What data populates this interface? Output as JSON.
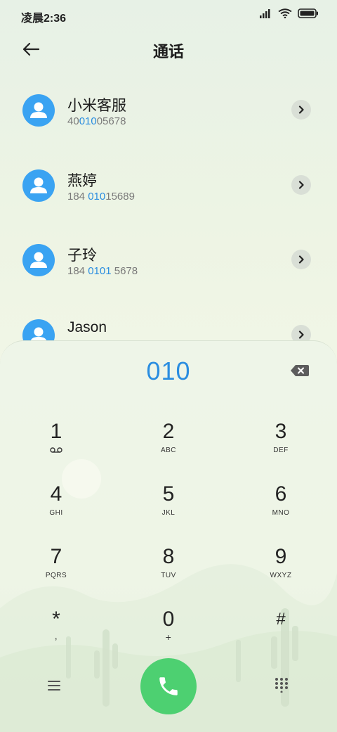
{
  "status_bar": {
    "time": "凌晨2:36"
  },
  "header": {
    "title": "通话"
  },
  "contacts": [
    {
      "name": "小米客服",
      "number_pre": "40",
      "number_hl": "010",
      "number_post": "05678"
    },
    {
      "name": "燕婷",
      "number_pre": "184 ",
      "number_hl": "010",
      "number_post": "15689"
    },
    {
      "name": "子玲",
      "number_pre": "184 ",
      "number_hl": "0101",
      "number_post": " 5678"
    },
    {
      "name": "Jason",
      "number_pre": "",
      "number_hl": "",
      "number_post": ""
    }
  ],
  "dialpad": {
    "input": "010",
    "keys": [
      {
        "digit": "1",
        "letters": ""
      },
      {
        "digit": "2",
        "letters": "ABC"
      },
      {
        "digit": "3",
        "letters": "DEF"
      },
      {
        "digit": "4",
        "letters": "GHI"
      },
      {
        "digit": "5",
        "letters": "JKL"
      },
      {
        "digit": "6",
        "letters": "MNO"
      },
      {
        "digit": "7",
        "letters": "PQRS"
      },
      {
        "digit": "8",
        "letters": "TUV"
      },
      {
        "digit": "9",
        "letters": "WXYZ"
      },
      {
        "digit": "*",
        "letters": ","
      },
      {
        "digit": "0",
        "letters": "+"
      },
      {
        "digit": "#",
        "letters": ""
      }
    ]
  },
  "icons": {
    "back": "arrow-left-icon",
    "voicemail": "voicemail-icon",
    "backspace": "backspace-icon",
    "call": "phone-icon",
    "menu": "menu-icon",
    "keypad": "keypad-grid-icon"
  },
  "colors": {
    "accent": "#2a8de0",
    "avatar": "#3aa3f2",
    "call": "#4dd071"
  }
}
